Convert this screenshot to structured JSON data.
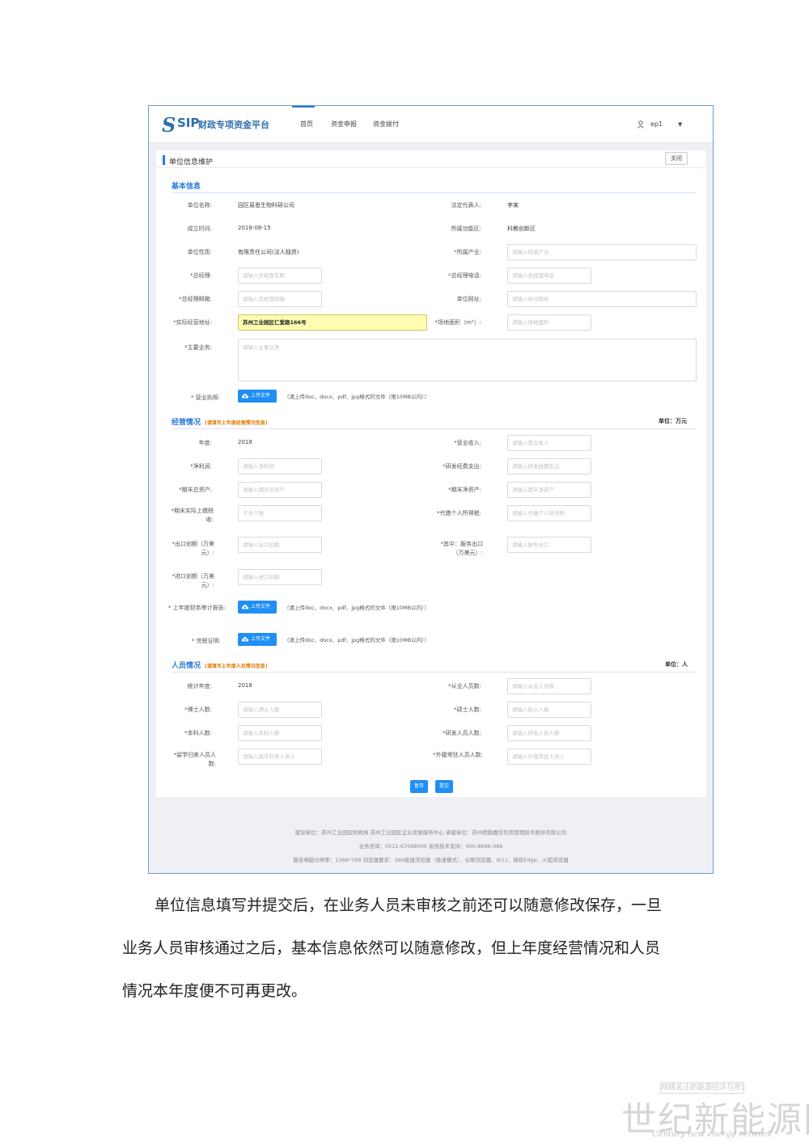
{
  "header": {
    "logo_mark": "S",
    "logo_sip": "SIP",
    "logo_name": "财政专项资金平台",
    "nav": [
      "首页",
      "资金申报",
      "资金拨付"
    ],
    "user": "ep1",
    "caret": "▼"
  },
  "panel": {
    "title": "单位信息维护",
    "close": "关闭"
  },
  "basic": {
    "title": "基本信息",
    "rows": [
      {
        "l1": "单位名称:",
        "v1": "园区易思生物科研公司",
        "l2": "法定代表人:",
        "v2": "李某"
      },
      {
        "l1": "成立时间:",
        "v1": "2018-08-15",
        "l2": "所属功能区:",
        "v2": "科教创新区"
      },
      {
        "l1": "单位性质:",
        "v1": "有限责任公司(法人独资)",
        "l2": "*所属产业:",
        "p2": "请输入所属产业"
      },
      {
        "l1": "*总经理:",
        "p1": "请输入总经理名称",
        "l2": "*总经理电话:",
        "p2": "请输入总经理电话"
      },
      {
        "l1": "*总经理邮箱:",
        "p1": "请输入总经理邮箱",
        "l2": "单位网址:",
        "p2": "请输入单位网址"
      },
      {
        "l1": "*实际经营地址:",
        "v1": "苏州工业园区仁爱路166号",
        "l2": "*场地面积（m²）:",
        "p2": "请输入场地面积"
      }
    ],
    "main_business_label": "*主要业务:",
    "main_business_placeholder": "请输入主要业务",
    "license_label": "* 营业执照:",
    "upload_label": "上传文件",
    "upload_hint": "（请上传doc、docx、pdf、jpg格式的文件（限10MB以内））"
  },
  "ops": {
    "title": "经营情况",
    "note": "(请填写上年度经营情况信息)",
    "unit": "单位：万元",
    "rows": [
      {
        "l1": "年度:",
        "v1": "2018",
        "l2": "*营业收入:",
        "p2": "请输入营业收入"
      },
      {
        "l1": "*净利润:",
        "p1": "请输入净利润",
        "l2": "*研发经费支出:",
        "p2": "请输入研发经费支出"
      },
      {
        "l1": "*期末总资产:",
        "p1": "请输入期末总资产",
        "l2": "*期末净资产:",
        "p2": "请输入期末净资产"
      },
      {
        "l1": "*期末实际上缴税收:",
        "p1": "不含个税",
        "l2": "*代缴个人所得税:",
        "p2": "请输入代缴个人所得税"
      },
      {
        "l1": "*出口创额（万美元）:",
        "p1": "请输入出口创额",
        "l2": "*其中：服务出口（万美元）:",
        "p2": "请输入服务出口"
      },
      {
        "l1": "*进口创额（万美元）:",
        "p1": "请输入进口创额"
      }
    ],
    "audit_label": "* 上年度财务审计报告:",
    "tax_label": "* 完税证明:"
  },
  "staff": {
    "title": "人员情况",
    "note": "(请填写上年度人员情况信息)",
    "unit": "单位：人",
    "rows": [
      {
        "l1": "统计年度:",
        "v1": "2018",
        "l2": "*从业人员数:",
        "p2": "请输入从业人员数"
      },
      {
        "l1": "*博士人数:",
        "p1": "请输入博士人数",
        "l2": "*硕士人数:",
        "p2": "请输入硕士人数"
      },
      {
        "l1": "*本科人数:",
        "p1": "请输入本科人数",
        "l2": "*研发人员人数:",
        "p2": "请输入研发人员人数"
      },
      {
        "l1": "*留学归来人员人数:",
        "p1": "请输入留学归来人员人",
        "l2": "*外籍常驻人员人数:",
        "p2": "请输入外籍常驻人员人"
      }
    ]
  },
  "actions": {
    "save": "暂存",
    "submit": "提交"
  },
  "footer": [
    "建设单位：苏州工业园区财政局 苏州工业园区企业发展服务中心   承建单位：苏州德融嘉信信用管理技术股份有限公司",
    "业务咨询：0512-67068000   系统技术支持：400-8696-086",
    "最佳电脑分辨率：1366*768   浏览器要求：360极速浏览器（极速模式）、谷歌浏览器、IE11、微软Edge、火狐浏览器"
  ],
  "paragraph": [
    "单位信息填写并提交后，在业务人员未审核之前还可以随意修改保存，一旦",
    "业务人员审核通过之后，基本信息依然可以随意修改，但上年度经营情况和人员",
    "情况本年度便不可再更改。"
  ],
  "watermark": {
    "top": "网络关注新能源经济与资讯",
    "big": "世纪新能源网",
    "en": "Century new energy network"
  },
  "colors": {
    "accent": "#2a7ad6",
    "button": "#1f8ef5",
    "note": "#e07b00",
    "highlight": "#fdfcb0"
  }
}
